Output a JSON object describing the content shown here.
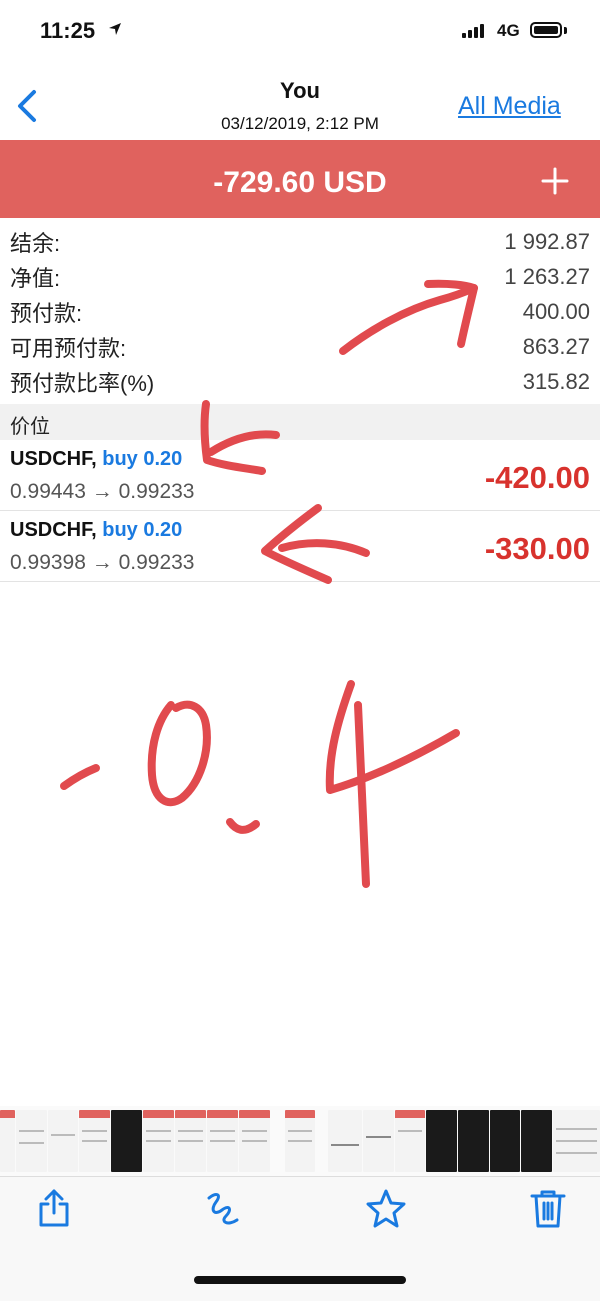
{
  "status": {
    "time": "11:25",
    "network": "4G"
  },
  "nav": {
    "title": "You",
    "subtitle": "03/12/2019, 2:12 PM",
    "all_media": "All Media"
  },
  "banner": {
    "total": "-729.60 USD"
  },
  "account": [
    {
      "label": "结余:",
      "value": "1 992.87"
    },
    {
      "label": "净值:",
      "value": "1 263.27"
    },
    {
      "label": "预付款:",
      "value": "400.00"
    },
    {
      "label": "可用预付款:",
      "value": "863.27"
    },
    {
      "label": "预付款比率(%)",
      "value": "315.82"
    }
  ],
  "section": {
    "label": "价位"
  },
  "positions": [
    {
      "symbol": "USDCHF,",
      "side": "buy 0.20",
      "prices": "0.99443 → 0.99233",
      "pl": "-420.00"
    },
    {
      "symbol": "USDCHF,",
      "side": "buy 0.20",
      "prices": "0.99398 → 0.99233",
      "pl": "-330.00"
    }
  ],
  "colors": {
    "accent_red": "#e0625e",
    "loss_red": "#d8322d",
    "link_blue": "#1a7ae0"
  },
  "icons": {
    "back": "chevron-left-icon",
    "plus": "plus-icon",
    "share": "share-icon",
    "markup": "markup-icon",
    "favorite": "star-icon",
    "delete": "trash-icon"
  }
}
